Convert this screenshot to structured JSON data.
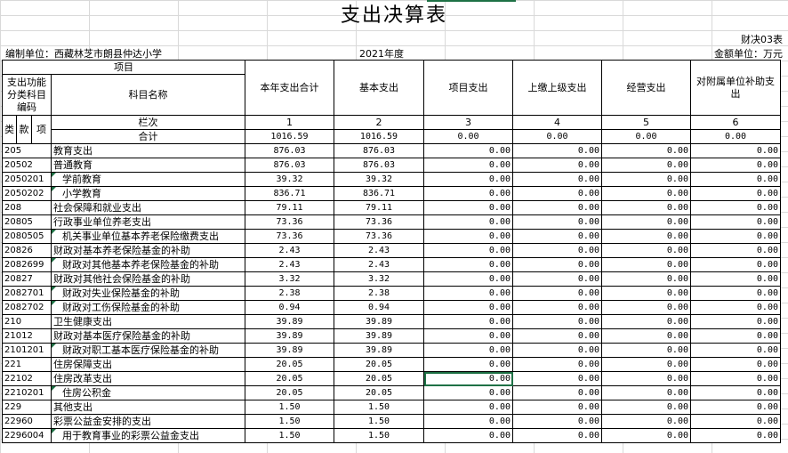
{
  "title": "支出决算表",
  "form_no": "财决03表",
  "unit_label": "编制单位：西藏林芝市朗县仲达小学",
  "year": "2021年度",
  "currency": "金额单位：万元",
  "headers": {
    "item": "项目",
    "func_class": "支出功能分类科目编码",
    "subject_name": "科目名称",
    "lei": "类",
    "kuan": "款",
    "xiang": "项",
    "lanci": "栏次",
    "heji": "合计",
    "cols": [
      "本年支出合计",
      "基本支出",
      "项目支出",
      "上缴上级支出",
      "经营支出",
      "对附属单位补助支出"
    ],
    "col_nums": [
      "1",
      "2",
      "3",
      "4",
      "5",
      "6"
    ]
  },
  "total": [
    "1016.59",
    "1016.59",
    "0.00",
    "0.00",
    "0.00",
    "0.00"
  ],
  "rows": [
    {
      "code": "205",
      "name": "教育支出",
      "indent": 0,
      "vals": [
        "876.03",
        "876.03",
        "0.00",
        "0.00",
        "0.00",
        "0.00"
      ]
    },
    {
      "code": "20502",
      "name": "普通教育",
      "indent": 0,
      "vals": [
        "876.03",
        "876.03",
        "0.00",
        "0.00",
        "0.00",
        "0.00"
      ]
    },
    {
      "code": "2050201",
      "name": "学前教育",
      "indent": 1,
      "vals": [
        "39.32",
        "39.32",
        "0.00",
        "0.00",
        "0.00",
        "0.00"
      ]
    },
    {
      "code": "2050202",
      "name": "小学教育",
      "indent": 1,
      "vals": [
        "836.71",
        "836.71",
        "0.00",
        "0.00",
        "0.00",
        "0.00"
      ]
    },
    {
      "code": "208",
      "name": "社会保障和就业支出",
      "indent": 0,
      "vals": [
        "79.11",
        "79.11",
        "0.00",
        "0.00",
        "0.00",
        "0.00"
      ]
    },
    {
      "code": "20805",
      "name": "行政事业单位养老支出",
      "indent": 0,
      "vals": [
        "73.36",
        "73.36",
        "0.00",
        "0.00",
        "0.00",
        "0.00"
      ]
    },
    {
      "code": "2080505",
      "name": "机关事业单位基本养老保险缴费支出",
      "indent": 1,
      "vals": [
        "73.36",
        "73.36",
        "0.00",
        "0.00",
        "0.00",
        "0.00"
      ]
    },
    {
      "code": "20826",
      "name": "财政对基本养老保险基金的补助",
      "indent": 0,
      "vals": [
        "2.43",
        "2.43",
        "0.00",
        "0.00",
        "0.00",
        "0.00"
      ]
    },
    {
      "code": "2082699",
      "name": "财政对其他基本养老保险基金的补助",
      "indent": 1,
      "vals": [
        "2.43",
        "2.43",
        "0.00",
        "0.00",
        "0.00",
        "0.00"
      ]
    },
    {
      "code": "20827",
      "name": "财政对其他社会保险基金的补助",
      "indent": 0,
      "vals": [
        "3.32",
        "3.32",
        "0.00",
        "0.00",
        "0.00",
        "0.00"
      ]
    },
    {
      "code": "2082701",
      "name": "财政对失业保险基金的补助",
      "indent": 1,
      "vals": [
        "2.38",
        "2.38",
        "0.00",
        "0.00",
        "0.00",
        "0.00"
      ]
    },
    {
      "code": "2082702",
      "name": "财政对工伤保险基金的补助",
      "indent": 1,
      "vals": [
        "0.94",
        "0.94",
        "0.00",
        "0.00",
        "0.00",
        "0.00"
      ]
    },
    {
      "code": "210",
      "name": "卫生健康支出",
      "indent": 0,
      "vals": [
        "39.89",
        "39.89",
        "0.00",
        "0.00",
        "0.00",
        "0.00"
      ]
    },
    {
      "code": "21012",
      "name": "财政对基本医疗保险基金的补助",
      "indent": 0,
      "vals": [
        "39.89",
        "39.89",
        "0.00",
        "0.00",
        "0.00",
        "0.00"
      ]
    },
    {
      "code": "2101201",
      "name": "财政对职工基本医疗保险基金的补助",
      "indent": 1,
      "vals": [
        "39.89",
        "39.89",
        "0.00",
        "0.00",
        "0.00",
        "0.00"
      ]
    },
    {
      "code": "221",
      "name": "住房保障支出",
      "indent": 0,
      "vals": [
        "20.05",
        "20.05",
        "0.00",
        "0.00",
        "0.00",
        "0.00"
      ]
    },
    {
      "code": "22102",
      "name": "住房改革支出",
      "indent": 0,
      "vals": [
        "20.05",
        "20.05",
        "0.00",
        "0.00",
        "0.00",
        "0.00"
      ]
    },
    {
      "code": "2210201",
      "name": "住房公积金",
      "indent": 1,
      "vals": [
        "20.05",
        "20.05",
        "0.00",
        "0.00",
        "0.00",
        "0.00"
      ]
    },
    {
      "code": "229",
      "name": "其他支出",
      "indent": 0,
      "vals": [
        "1.50",
        "1.50",
        "0.00",
        "0.00",
        "0.00",
        "0.00"
      ]
    },
    {
      "code": "22960",
      "name": "彩票公益金安排的支出",
      "indent": 0,
      "vals": [
        "1.50",
        "1.50",
        "0.00",
        "0.00",
        "0.00",
        "0.00"
      ]
    },
    {
      "code": "2296004",
      "name": "用于教育事业的彩票公益金支出",
      "indent": 1,
      "vals": [
        "1.50",
        "1.50",
        "0.00",
        "0.00",
        "0.00",
        "0.00"
      ]
    }
  ],
  "colors": {
    "grid": "#d9d9d9",
    "selection": "#1e7145",
    "text": "#000000"
  }
}
